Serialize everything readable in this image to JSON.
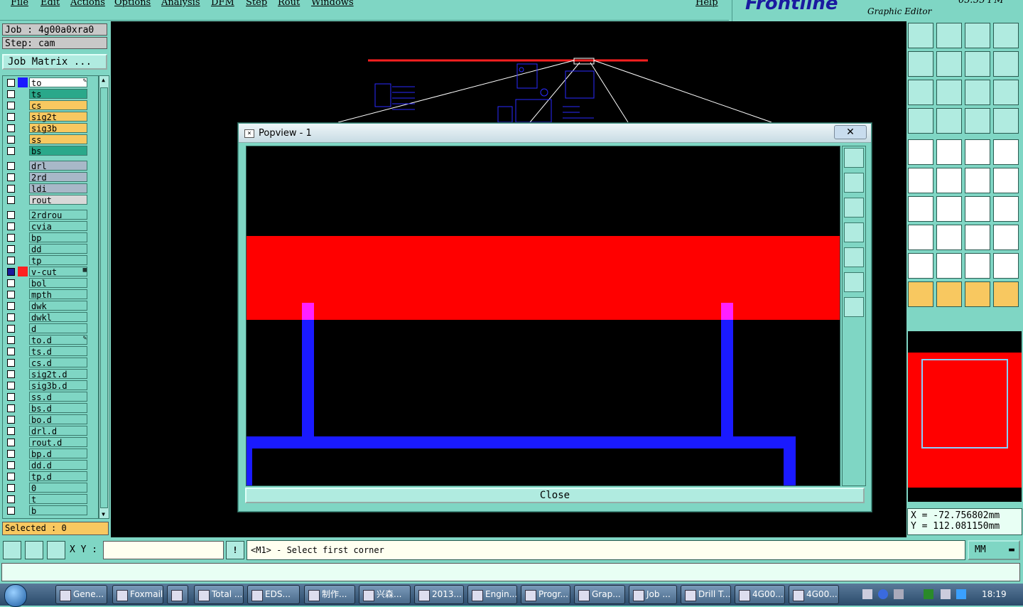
{
  "menu": {
    "items": [
      "File",
      "Edit",
      "Actions",
      "Options",
      "Analysis",
      "DFM",
      "Step",
      "Rout",
      "Windows"
    ],
    "help": "Help"
  },
  "brand": {
    "logo": "Frontline",
    "subtitle": "Graphic Editor",
    "time": "05:55 PM"
  },
  "job": {
    "job_label": "Job : 4g00a0xra0",
    "step_label": "Step: cam",
    "matrix_button": "Job Matrix ..."
  },
  "layers": [
    {
      "name": "to",
      "color": "#ffffff",
      "swatch": "#1a1aff",
      "mark": "✎"
    },
    {
      "name": "ts",
      "color": "#2aa88a"
    },
    {
      "name": "cs",
      "color": "#f8c860"
    },
    {
      "name": "sig2t",
      "color": "#f8c860"
    },
    {
      "name": "sig3b",
      "color": "#f8c860"
    },
    {
      "name": "ss",
      "color": "#f8c860"
    },
    {
      "name": "bs",
      "color": "#2aa88a"
    },
    {
      "name": "drl",
      "color": "#a8b8c8"
    },
    {
      "name": "2rd",
      "color": "#a8b8c8"
    },
    {
      "name": "ldi",
      "color": "#a8b8c8"
    },
    {
      "name": "rout",
      "color": "#d8d8d8"
    },
    {
      "name": "2rdrou",
      "color": "#7fd6c4"
    },
    {
      "name": "cvia",
      "color": "#7fd6c4"
    },
    {
      "name": "bp",
      "color": "#7fd6c4"
    },
    {
      "name": "dd",
      "color": "#7fd6c4"
    },
    {
      "name": "tp",
      "color": "#7fd6c4"
    },
    {
      "name": "v-cut",
      "color": "#7fd6c4",
      "swatch": "#ff2020",
      "selected": true,
      "mark": "▦"
    },
    {
      "name": "bol",
      "color": "#7fd6c4"
    },
    {
      "name": "mpth",
      "color": "#7fd6c4"
    },
    {
      "name": "dwk",
      "color": "#7fd6c4"
    },
    {
      "name": "dwkl",
      "color": "#7fd6c4"
    },
    {
      "name": "d",
      "color": "#7fd6c4"
    },
    {
      "name": "to.d",
      "color": "#7fd6c4",
      "mark": "✎"
    },
    {
      "name": "ts.d",
      "color": "#7fd6c4"
    },
    {
      "name": "cs.d",
      "color": "#7fd6c4"
    },
    {
      "name": "sig2t.d",
      "color": "#7fd6c4"
    },
    {
      "name": "sig3b.d",
      "color": "#7fd6c4"
    },
    {
      "name": "ss.d",
      "color": "#7fd6c4"
    },
    {
      "name": "bs.d",
      "color": "#7fd6c4"
    },
    {
      "name": "bo.d",
      "color": "#7fd6c4"
    },
    {
      "name": "drl.d",
      "color": "#7fd6c4"
    },
    {
      "name": "rout.d",
      "color": "#7fd6c4"
    },
    {
      "name": "bp.d",
      "color": "#7fd6c4"
    },
    {
      "name": "dd.d",
      "color": "#7fd6c4"
    },
    {
      "name": "tp.d",
      "color": "#7fd6c4"
    },
    {
      "name": "0",
      "color": "#7fd6c4"
    },
    {
      "name": "t",
      "color": "#7fd6c4"
    },
    {
      "name": "b",
      "color": "#7fd6c4"
    }
  ],
  "selected_label": "Selected : 0",
  "popview": {
    "title": "Popview - 1",
    "close_x": "✕",
    "close_button": "Close"
  },
  "coords": {
    "x": "X = -72.756802mm",
    "y": "Y = 112.081150mm"
  },
  "bottom": {
    "xy_label": "X Y :",
    "xy_value": "",
    "prompt": "<M1> - Select first corner",
    "units": "MM"
  },
  "taskbar": {
    "tasks": [
      "Gene...",
      "Foxmail",
      "",
      "Total ...",
      "EDS...",
      "制作...",
      "兴森...",
      "2013...",
      "Engin...",
      "Progr...",
      "Grap...",
      "Job ...",
      "Drill T...",
      "4G00...",
      "4G00..."
    ],
    "clock": "18:19"
  }
}
